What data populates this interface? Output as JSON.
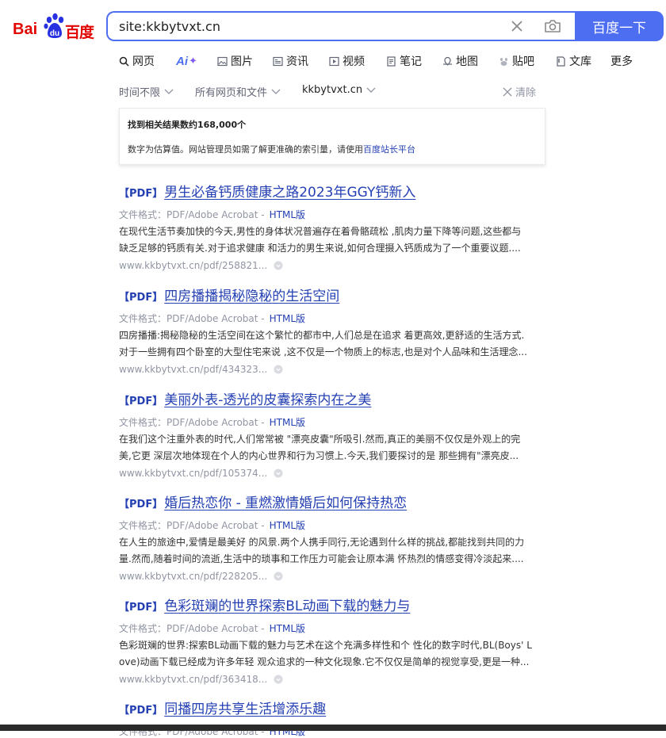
{
  "logo": {
    "left": "Bai",
    "right": "百度"
  },
  "search": {
    "query": "site:kkbytvxt.cn",
    "button_label": "百度一下"
  },
  "tabs": [
    {
      "label": "网页",
      "icon": "search-icon",
      "active": true
    },
    {
      "label": "",
      "icon": "ai-icon"
    },
    {
      "label": "图片",
      "icon": "image-icon"
    },
    {
      "label": "资讯",
      "icon": "news-icon"
    },
    {
      "label": "视频",
      "icon": "video-icon"
    },
    {
      "label": "笔记",
      "icon": "notes-icon"
    },
    {
      "label": "地图",
      "icon": "map-icon"
    },
    {
      "label": "贴吧",
      "icon": "tieba-icon"
    },
    {
      "label": "文库",
      "icon": "wenku-icon"
    },
    {
      "label": "更多",
      "icon": ""
    }
  ],
  "ai_label": "Ai",
  "filters": {
    "time": "时间不限",
    "type": "所有网页和文件",
    "site": "kkbytvxt.cn",
    "clear": "清除"
  },
  "info": {
    "count_text": "找到相关结果数约168,000个",
    "desc_text": "数字为估算值。网站管理员如需了解更准确的索引量，请使用",
    "link_text": "百度站长平台"
  },
  "results": [
    {
      "tag": "【PDF】",
      "title": "男生必备钙质健康之路2023年GGY钙新入",
      "meta": "文件格式：PDF/Adobe Acrobat -",
      "html_link": "HTML版",
      "line1": "在现代生活节奏加快的今天,男性的身体状况普遍存在着骨骼疏松 ,肌肉力量下降等问题,这些都与",
      "line2": "缺乏足够的钙质有关.对于追求健康 和活力的男生来说,如何合理摄入钙质成为了一个重要议题....",
      "url": "www.kkbytvxt.cn/pdf/258821..."
    },
    {
      "tag": "【PDF】",
      "title": "四房播播揭秘隐秘的生活空间",
      "meta": "文件格式：PDF/Adobe Acrobat -",
      "html_link": "HTML版",
      "line1": "四房播播:揭秘隐秘的生活空间在这个繁忙的都市中,人们总是在追求 着更高效,更舒适的生活方式.",
      "line2": "对于一些拥有四个卧室的大型住宅来说 ,这不仅是一个物质上的标志,也是对个人品味和生活理念...",
      "url": "www.kkbytvxt.cn/pdf/434323..."
    },
    {
      "tag": "【PDF】",
      "title": "美丽外表-透光的皮囊探索内在之美",
      "meta": "文件格式：PDF/Adobe Acrobat -",
      "html_link": "HTML版",
      "line1": "在我们这个注重外表的时代,人们常常被 \"漂亮皮囊\"所吸引.然而,真正的美丽不仅仅是外观上的完",
      "line2": "美,它更 深层次地体现在个人的内心世界和行为习惯上.今天,我们要探讨的是 那些拥有\"漂亮皮...",
      "url": "www.kkbytvxt.cn/pdf/105374..."
    },
    {
      "tag": "【PDF】",
      "title": "婚后热恋你 - 重燃激情婚后如何保持热恋",
      "meta": "文件格式：PDF/Adobe Acrobat -",
      "html_link": "HTML版",
      "line1": "在人生的旅途中,爱情是最美好 的风景.两个人携手同行,无论遇到什么样的挑战,都能找到共同的力",
      "line2": "量.然而,随着时间的流逝,生活中的琐事和工作压力可能会让原本满 怀热烈的情感变得冷淡起来....",
      "url": "www.kkbytvxt.cn/pdf/228205..."
    },
    {
      "tag": "【PDF】",
      "title": "色彩斑斓的世界探索BL动画下载的魅力与",
      "meta": "文件格式：PDF/Adobe Acrobat -",
      "html_link": "HTML版",
      "line1": "色彩斑斓的世界:探索BL动画下载的魅力与艺术在这个充满多样性和个 性化的数字时代,BL(Boys' L",
      "line2": "ove)动画下载已经成为许多年轻 观众追求的一种文化现象.它不仅仅是简单的视觉享受,更是一种...",
      "url": "www.kkbytvxt.cn/pdf/363418..."
    },
    {
      "tag": "【PDF】",
      "title": "同播四房共享生活增添乐趣",
      "meta": "文件格式：PDF/Adobe Acrobat -",
      "html_link": "HTML版",
      "line1": "",
      "line2": "",
      "url": ""
    }
  ]
}
